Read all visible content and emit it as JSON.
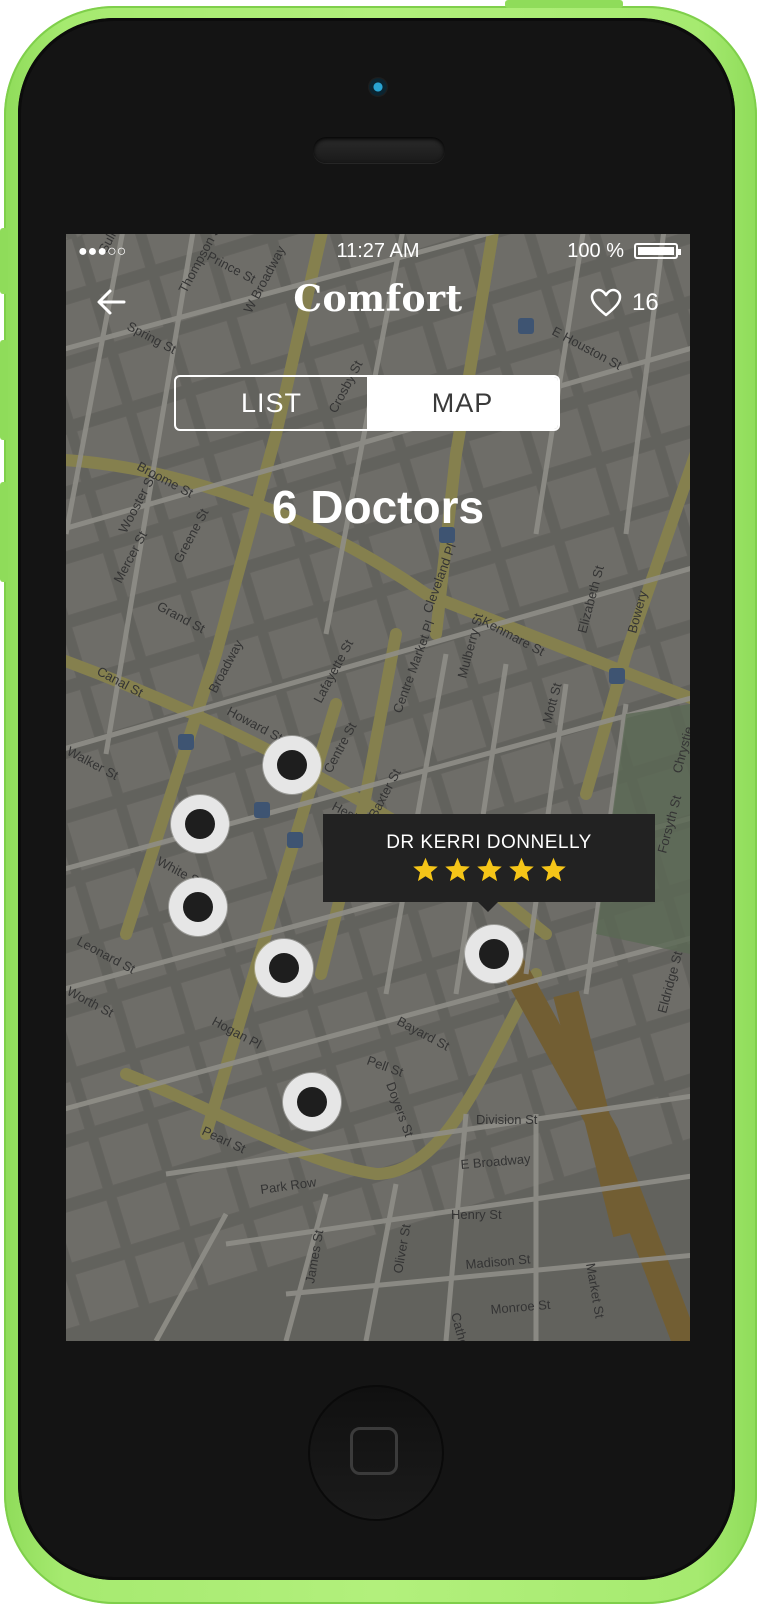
{
  "status_bar": {
    "signal": "●●●○○",
    "time": "11:27 AM",
    "battery": "100 %"
  },
  "header": {
    "back_icon": "arrow-left-icon",
    "logo": "Comfort",
    "favorites_icon": "heart-outline-icon",
    "favorites_count": "16"
  },
  "segmented_control": {
    "options": [
      "LIST",
      "MAP"
    ],
    "selected": "MAP"
  },
  "results_title": "6 Doctors",
  "map": {
    "street_labels": [
      "Thompson St",
      "Prince St",
      "W Broadway",
      "Spring St",
      "Broome St",
      "Grand St",
      "Canal St",
      "Howard St",
      "Lafayette St",
      "Centre St",
      "Baxter St",
      "Mulberry St",
      "Mott St",
      "Elizabeth St",
      "Bowery",
      "Kenmare St",
      "Hester St",
      "Walker St",
      "White St",
      "Leonard St",
      "Worth St",
      "Hogan Pl",
      "Bayard St",
      "Pell St",
      "Doyers St",
      "Division St",
      "E Broadway",
      "Henry St",
      "Madison St",
      "Monroe St",
      "Park Row",
      "Pearl St",
      "James St",
      "Oliver St",
      "Catherine St",
      "Market St",
      "Forsyth St",
      "Eldridge St",
      "E Houston St",
      "Cleveland Pl",
      "Centre Market Pl",
      "Mercer St",
      "Greene St",
      "Wooster St",
      "Chrystie",
      "Sullivan St",
      "Crosby St",
      "Broadway"
    ]
  },
  "pins_count": 6,
  "callout": {
    "name": "DR KERRI DONNELLY",
    "rating": 5,
    "rating_max": 5,
    "star_color": "#f5c518"
  },
  "colors": {
    "phone_body": "#a6ea70",
    "callout_bg": "#222222"
  }
}
